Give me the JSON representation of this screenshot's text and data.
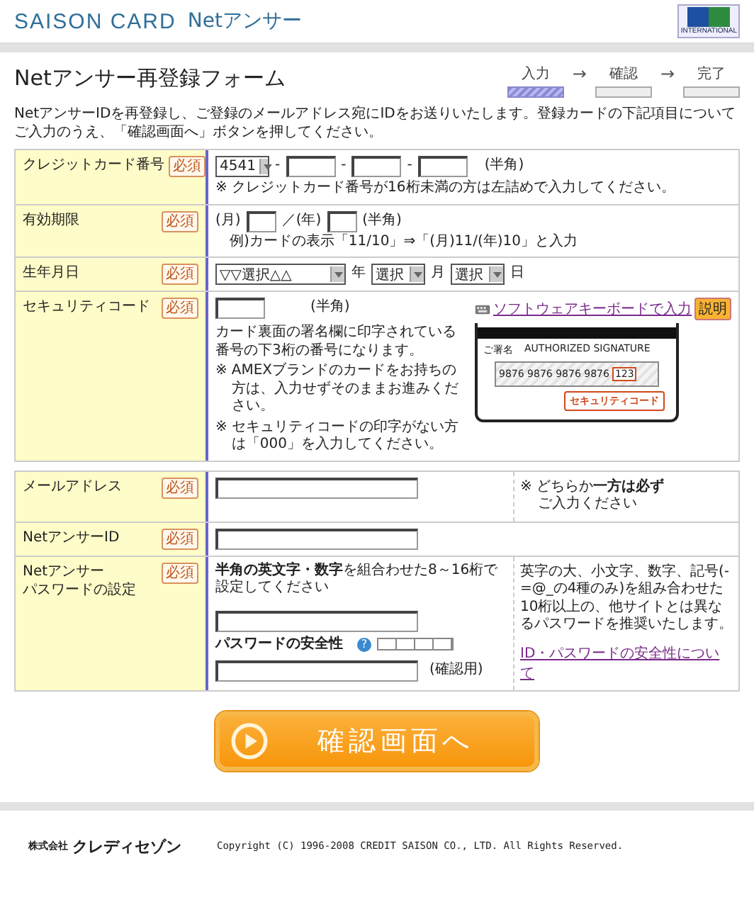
{
  "header": {
    "brand": "SAISON CARD",
    "product": "Netアンサー",
    "logo_text": "INTERNATIONAL"
  },
  "title": "Netアンサー再登録フォーム",
  "steps": [
    {
      "label": "入力",
      "selected": true
    },
    {
      "label": "確認",
      "selected": false
    },
    {
      "label": "完了",
      "selected": false
    }
  ],
  "step_arrows": [
    "→",
    "→"
  ],
  "intro": "NetアンサーIDを再登録し、ご登録のメールアドレス宛にIDをお送りいたします。登録カードの下記項目についてご入力のうえ、「確認画面へ」ボタンを押してください。",
  "card_section": [
    {
      "kind": "card_number",
      "label": "クレジットカード番号",
      "badge": "必須",
      "select": "4541",
      "separators": [
        "-",
        "-",
        "-"
      ],
      "unit": "(半角)",
      "hint": "※ クレジットカード番号が16桁未満の方は左詰めで入力してください。"
    },
    {
      "kind": "expiry",
      "label": "有効期限",
      "badge": "必須",
      "month": "(月)",
      "year": "／(年)",
      "unit": "(半角)",
      "example": "例)カードの表示「11/10」⇒「(月)11/(年)10」と入力"
    },
    {
      "kind": "birthdate",
      "label": "生年月日",
      "badge": "必須",
      "selects": [
        {
          "value": "▽▽選択△△",
          "unit": "年"
        },
        {
          "value": "選択",
          "unit": "月"
        },
        {
          "value": "選択",
          "unit": "日"
        }
      ]
    },
    {
      "kind": "security",
      "label": "セキュリティコード",
      "badge": "必須",
      "unit": "(半角)",
      "description": "カード裏面の署名欄に印字されている番号の下3桁の番号になります。",
      "notes": [
        {
          "mark": "※",
          "text": "AMEXブランドのカードをお持ちの方は、入力せずそのままお進みください。"
        },
        {
          "mark": "※",
          "text": "セキュリティコードの印字がない方は「000」を入力してください。"
        }
      ],
      "keyboard_link": "ソフトウェアキーボードで入力",
      "help": "説明",
      "card": {
        "signature_label": "ご署名",
        "signature_en": "AUTHORIZED SIGNATURE",
        "numbers": "9876 9876 9876 9876",
        "code": "123",
        "callout": "セキュリティコード"
      }
    }
  ],
  "account_section": [
    {
      "kind": "email",
      "label": "メールアドレス",
      "badge": "必須",
      "side_note": "※ どちらか**一方は必ず**",
      "side_note_2": "ご入力ください"
    },
    {
      "kind": "id",
      "label": "NetアンサーID",
      "badge": "必須"
    },
    {
      "kind": "password",
      "label": "Netアンサー",
      "label_2": "パスワードの設定",
      "badge": "必須",
      "instruction": "**半角の英文字・数字**を組合わせた8～16桁で設定してください",
      "strength_label": "パスワードの安全性",
      "strength_help": "?",
      "strength": {
        "level": 0
      },
      "confirm_label": "(確認用)",
      "side_note": "英字の大、小文字、数字、記号(-=@_の4種のみ)を組み合わせた10桁以上の、他サイトとは異なるパスワードを推奨いたします。",
      "side_link": "ID・パスワードの安全性について"
    }
  ],
  "submit": "確認画面へ",
  "footer": {
    "company_prefix": "株式会社",
    "company": "クレディセゾン",
    "copyright": "Copyright (C) 1996-2008 CREDIT SAISON CO., LTD. All Rights Reserved."
  }
}
